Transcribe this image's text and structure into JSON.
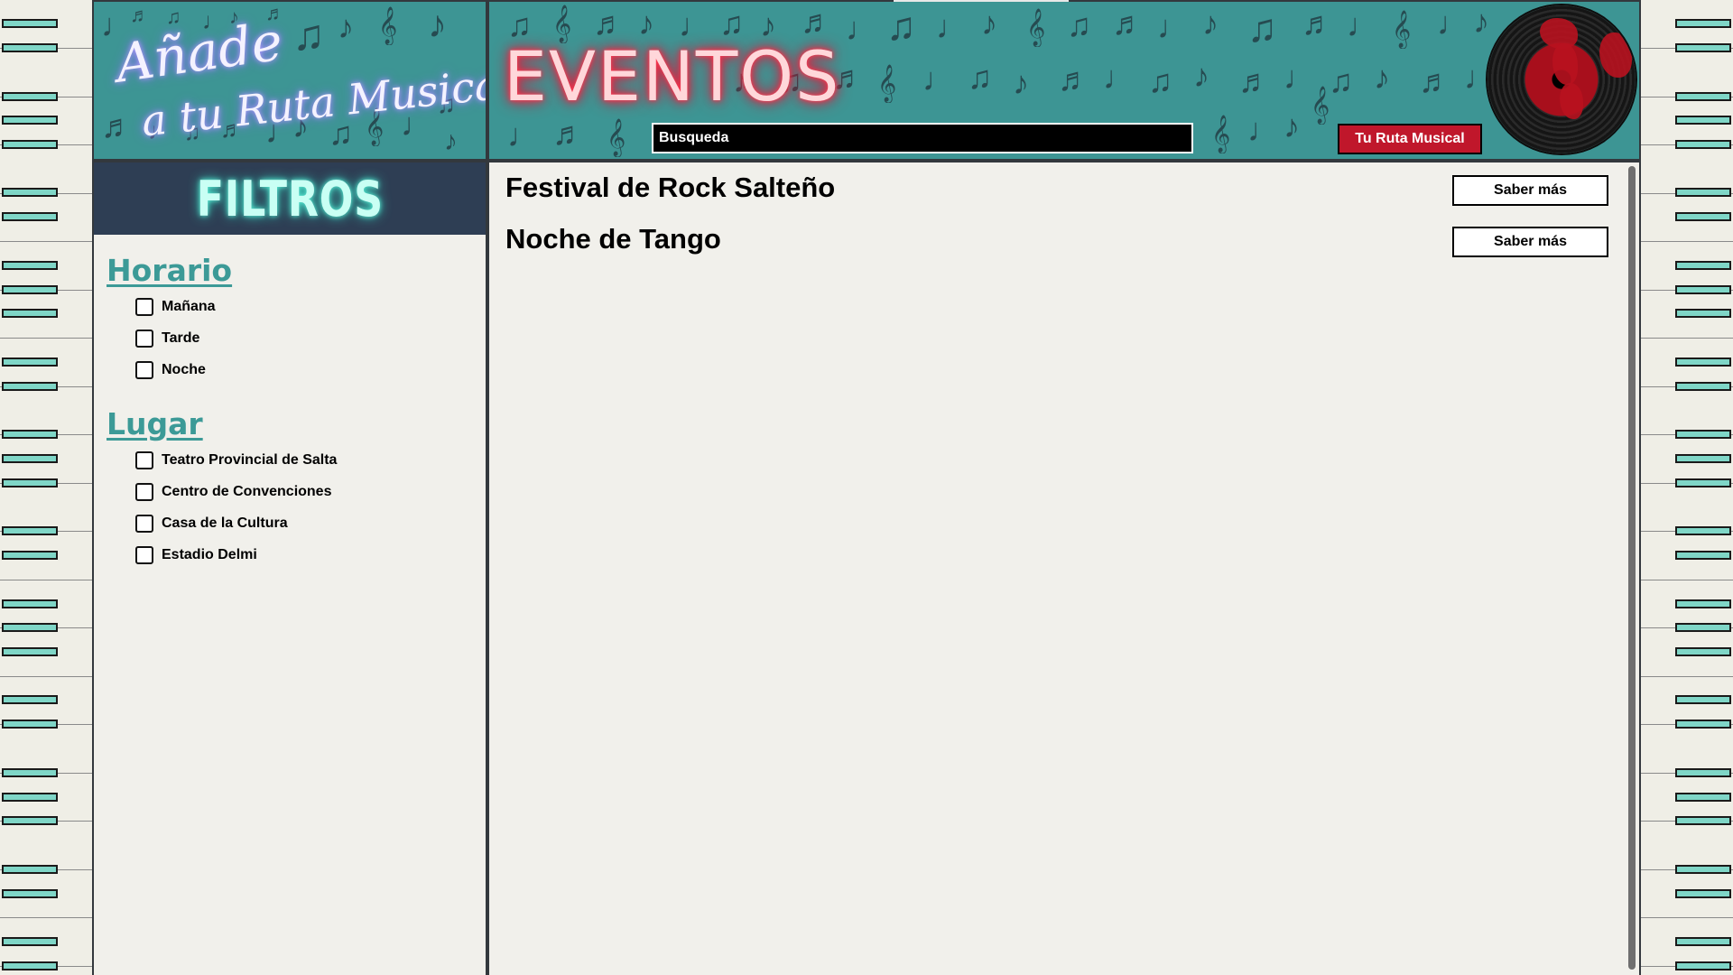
{
  "header": {
    "logo_line1": "Añade",
    "logo_line2": "a tu Ruta Musical",
    "section_title": "EVENTOS",
    "search_placeholder": "Busqueda",
    "route_button": "Tu Ruta Musical"
  },
  "sidebar": {
    "title": "FILTROS",
    "sections": [
      {
        "title": "Horario",
        "options": [
          "Mañana",
          "Tarde",
          "Noche"
        ]
      },
      {
        "title": "Lugar",
        "options": [
          "Teatro Provincial de Salta",
          "Centro de Convenciones",
          "Casa de la Cultura",
          "Estadio Delmi"
        ]
      }
    ]
  },
  "events": [
    {
      "title": "Festival de Rock Salteño",
      "button": "Saber más"
    },
    {
      "title": "Noche de Tango",
      "button": "Saber más"
    }
  ],
  "colors": {
    "teal": "#3d9594",
    "accent_red": "#c0172b",
    "navy": "#2e3e54"
  }
}
